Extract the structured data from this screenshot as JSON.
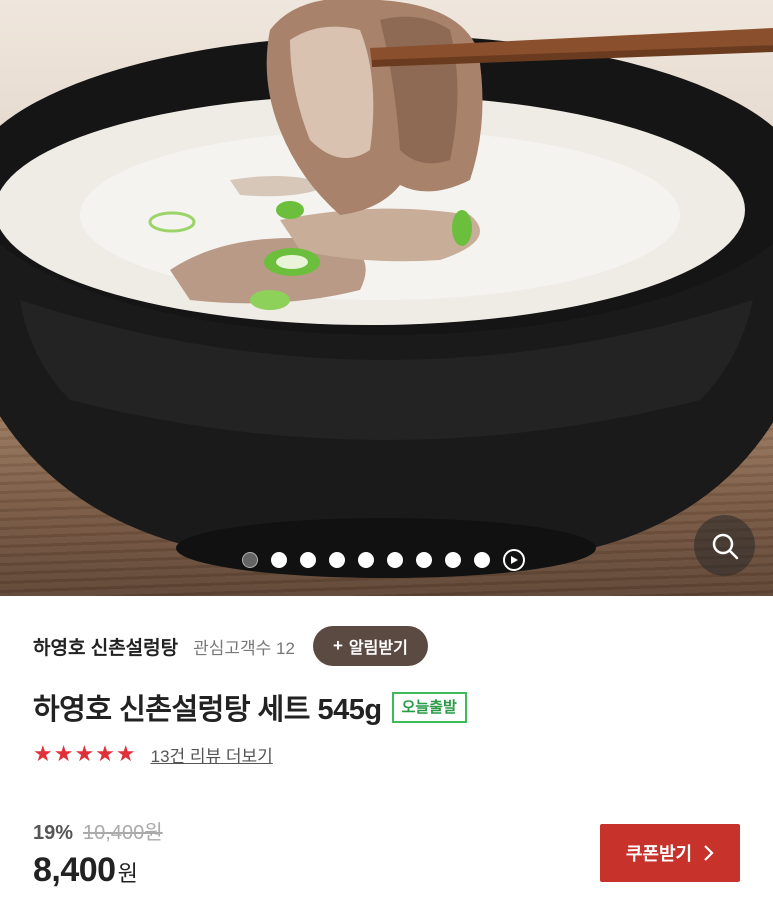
{
  "gallery": {
    "image_description": "설렁탕",
    "slide_count": 9,
    "active_slide": 1
  },
  "seller": {
    "name": "하영호 신촌설렁탕",
    "fans_label": "관심고객수 12",
    "alert_label": "알림받기"
  },
  "product": {
    "title": "하영호 신촌설렁탕 세트 545g",
    "shipping_badge": "오늘출발",
    "rating_stars": 5,
    "review_link": "13건 리뷰 더보기"
  },
  "price": {
    "discount": "19%",
    "original": "10,400원",
    "current": "8,400",
    "currency": "원"
  },
  "coupon": {
    "label": "쿠폰받기"
  },
  "colors": {
    "alert_bg": "#5a4a42",
    "badge_green": "#3dbb5a",
    "star_red": "#e0313a",
    "coupon_red": "#c7332b"
  }
}
